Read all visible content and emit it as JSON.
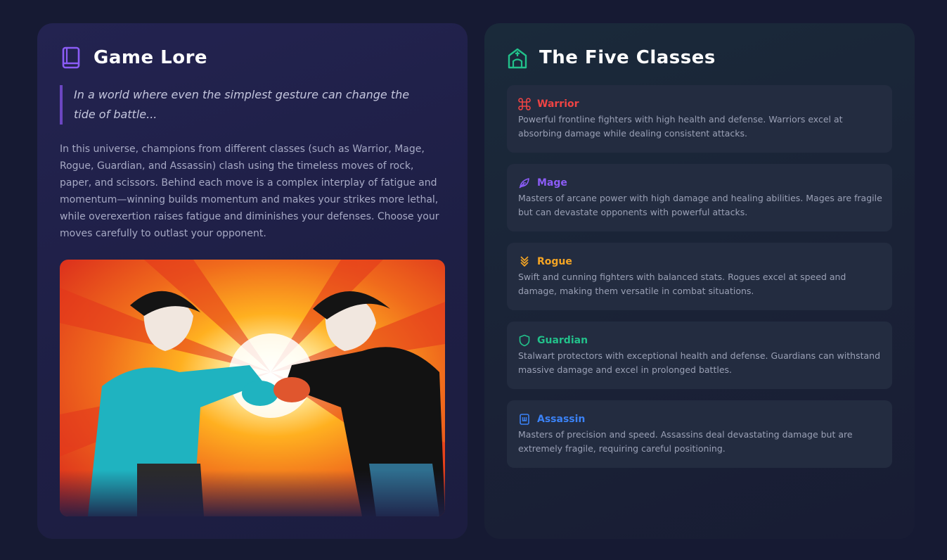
{
  "lore": {
    "title": "Game Lore",
    "icon": "book-icon",
    "quote": "In a world where even the simplest gesture can change the tide of battle...",
    "body": "In this universe, champions from different classes (such as Warrior, Mage, Rogue, Guardian, and Assassin) clash using the timeless moves of rock, paper, and scissors. Behind each move is a complex interplay of fatigue and momentum—winning builds momentum and makes your strikes more lethal, while overexertion raises fatigue and diminishes your defenses. Choose your moves carefully to outlast your opponent."
  },
  "classes": {
    "title": "The Five Classes",
    "icon": "church-icon",
    "items": [
      {
        "name": "Warrior",
        "icon": "command-icon",
        "color": "#ef4444",
        "description": "Powerful frontline fighters with high health and defense. Warriors excel at absorbing damage while dealing consistent attacks."
      },
      {
        "name": "Mage",
        "icon": "feather-icon",
        "color": "#8b5cf6",
        "description": "Masters of arcane power with high damage and healing abilities. Mages are fragile but can devastate opponents with powerful attacks."
      },
      {
        "name": "Rogue",
        "icon": "chevrons-down-icon",
        "color": "#f5a524",
        "description": "Swift and cunning fighters with balanced stats. Rogues excel at speed and damage, making them versatile in combat situations."
      },
      {
        "name": "Guardian",
        "icon": "shield-icon",
        "color": "#22c08a",
        "description": "Stalwart protectors with exceptional health and defense. Guardians can withstand massive damage and excel in prolonged battles."
      },
      {
        "name": "Assassin",
        "icon": "badge-icon",
        "color": "#3b82f6",
        "description": "Masters of precision and speed. Assassins deal devastating damage but are extremely fragile, requiring careful positioning."
      }
    ]
  },
  "colors": {
    "lore_icon": "#8b5cf6",
    "classes_icon": "#22c08a",
    "quote_border": "#6b46c1"
  }
}
